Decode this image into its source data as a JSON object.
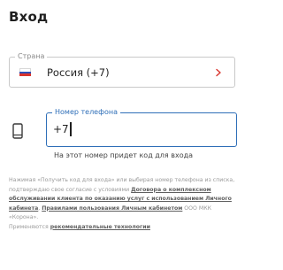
{
  "header": {
    "title": "Вход"
  },
  "country": {
    "label": "Страна",
    "value": "Россия (+7)",
    "flag_icon": "russia-flag-icon",
    "chevron_icon": "chevron-right-icon",
    "chevron_color": "#d8332c"
  },
  "phone": {
    "icon": "smartphone-icon",
    "label": "Номер телефона",
    "value": "+7",
    "hint": "На этот номер придет код для входа",
    "accent_color": "#2f6fb8"
  },
  "legal": {
    "text_1": "Нажимая «Получить код для входа» или выбирая номер телефона из списка, подтверждаю свое согласие с условиями ",
    "link_1": "Договора о комплексном обслуживании клиента по оказанию услуг с использованием Личного кабинета",
    "text_2": ", ",
    "link_2": "Правилами пользования Личным кабинетом",
    "text_3": " ООО МКК «Корона».",
    "text_4": "Применяются ",
    "link_3": "рекомендательные технологии"
  }
}
